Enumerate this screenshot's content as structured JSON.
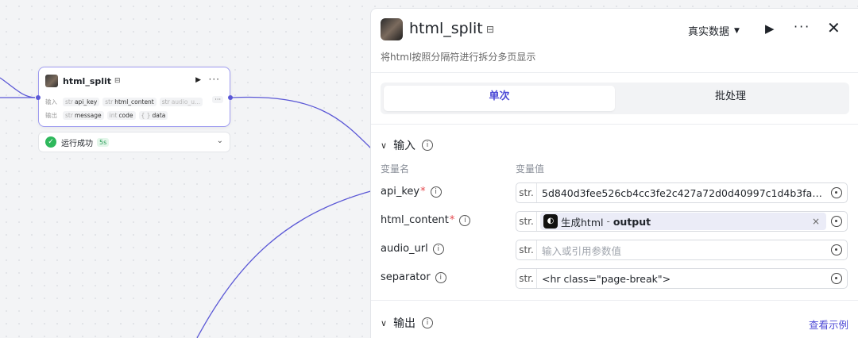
{
  "node": {
    "title": "html_split",
    "inputs_label": "输入",
    "outputs_label": "输出",
    "inputs": [
      {
        "type": "str",
        "name": "api_key"
      },
      {
        "type": "str",
        "name": "html_content"
      },
      {
        "type": "str",
        "name": "audio_u..."
      }
    ],
    "more_inputs": "···",
    "outputs": [
      {
        "type": "str",
        "name": "message"
      },
      {
        "type": "int",
        "name": "code"
      },
      {
        "type": "{ }",
        "name": "data"
      }
    ],
    "status": {
      "text": "运行成功",
      "time": "5s"
    }
  },
  "panel": {
    "title": "html_split",
    "description": "将html按照分隔符进行拆分多页显示",
    "data_source": "真实数据",
    "tabs": [
      {
        "label": "单次",
        "active": true
      },
      {
        "label": "批处理",
        "active": false
      }
    ],
    "input_section": "输入",
    "col_name": "变量名",
    "col_value": "变量值",
    "params": [
      {
        "name": "api_key",
        "required": "*",
        "type": "str.",
        "value": "5d840d3fee526cb4cc3fe2c427a72d0d40997c1d4b3faa..."
      },
      {
        "name": "html_content",
        "required": "*",
        "type": "str.",
        "ref_node": "生成html",
        "ref_sep": "-",
        "ref_var": "output"
      },
      {
        "name": "audio_url",
        "required": "",
        "type": "str.",
        "placeholder": "输入或引用参数值"
      },
      {
        "name": "separator",
        "required": "",
        "type": "str.",
        "value": "<hr class=\"page-break\">"
      }
    ],
    "output_section": "输出",
    "example_link": "查看示例"
  },
  "colors": {
    "accent": "#4d4ad6",
    "edge": "#5b58d6",
    "success": "#2eb85c",
    "required": "#e5484d"
  }
}
